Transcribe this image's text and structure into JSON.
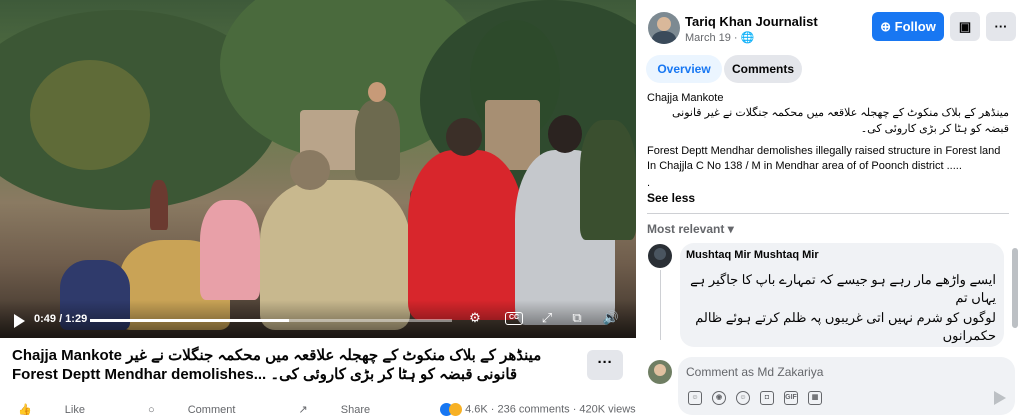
{
  "video": {
    "time": "0:49 / 1:29",
    "progress": 0.55,
    "controls": [
      "play-icon",
      "settings-icon",
      "captions-icon",
      "fullscreen-icon",
      "pip-icon",
      "volume-icon"
    ],
    "cc_label": "CC"
  },
  "post": {
    "title_latin": "Chajja Mankote",
    "title_urdu_1": "مینڈھر کے بلاک منکوٹ کے چھجلہ علاقعہ میں محکمہ جنگلات نے غیر",
    "title_urdu_2": "قانونی قبضہ کو ہٹا کر بڑی کاروئی کی۔",
    "title_latin_2": "Forest Deptt Mendhar demolishes...",
    "more_label": "···",
    "actions": {
      "like": "Like",
      "comment": "Comment",
      "share": "Share"
    },
    "stats": {
      "reactions": "4.6K",
      "comments": "236 comments",
      "views": "420K views"
    }
  },
  "header": {
    "author": "Tariq Khan Journalist",
    "date": "March 19 · ",
    "follow_label": "Follow",
    "more_label": "···"
  },
  "tabs": [
    {
      "label": "Overview",
      "active": true
    },
    {
      "label": "Comments",
      "active": false
    }
  ],
  "description": {
    "line1": "Chajja Mankote",
    "urdu_a": "مینڈھر کے بلاک منکوٹ کے چھجلہ علاقعہ میں محکمہ جنگلات نے غیر قانونی",
    "urdu_b": "قبضہ کو ہٹا کر بڑی کاروئی کی۔",
    "english": "Forest Deptt Mendhar demolishes illegally raised structure in Forest land In Chajjla C No 138 / M in Mendhar area of of Poonch district .....",
    "dot": ".",
    "see_less": "See less"
  },
  "comments": {
    "sort_label": "Most relevant",
    "items": [
      {
        "author": "Mushtaq Mir Mushtaq Mir",
        "lines": [
          "ایسے واڑھے مار رہے ہو جیسے کہ تمہارے باپ کا جاگیر ہے یہاں تم",
          "لوگوں کو شرم نہیں اتی غریبوں پہ ظلم کرتے ہوئے ظالم حکمرانوں"
        ]
      }
    ],
    "input_placeholder": "Comment as Md Zakariya"
  },
  "colors": {
    "accent": "#1877f2",
    "text": "#050505",
    "muted": "#65676b",
    "surface": "#f0f2f5"
  }
}
